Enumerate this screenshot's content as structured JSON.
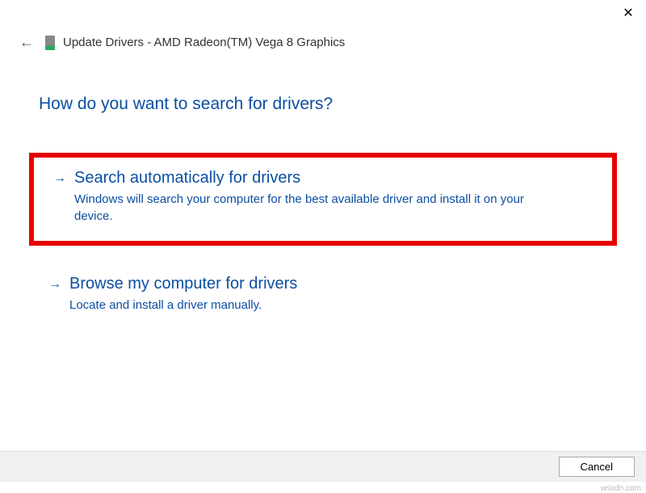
{
  "header": {
    "title": "Update Drivers - AMD Radeon(TM) Vega 8 Graphics"
  },
  "content": {
    "question": "How do you want to search for drivers?",
    "options": [
      {
        "title": "Search automatically for drivers",
        "description": "Windows will search your computer for the best available driver and install it on your device."
      },
      {
        "title": "Browse my computer for drivers",
        "description": "Locate and install a driver manually."
      }
    ]
  },
  "footer": {
    "cancel_label": "Cancel"
  },
  "watermark": "wsxdn.com",
  "colors": {
    "accent": "#0b4ea2",
    "highlight_border": "#e60000"
  }
}
